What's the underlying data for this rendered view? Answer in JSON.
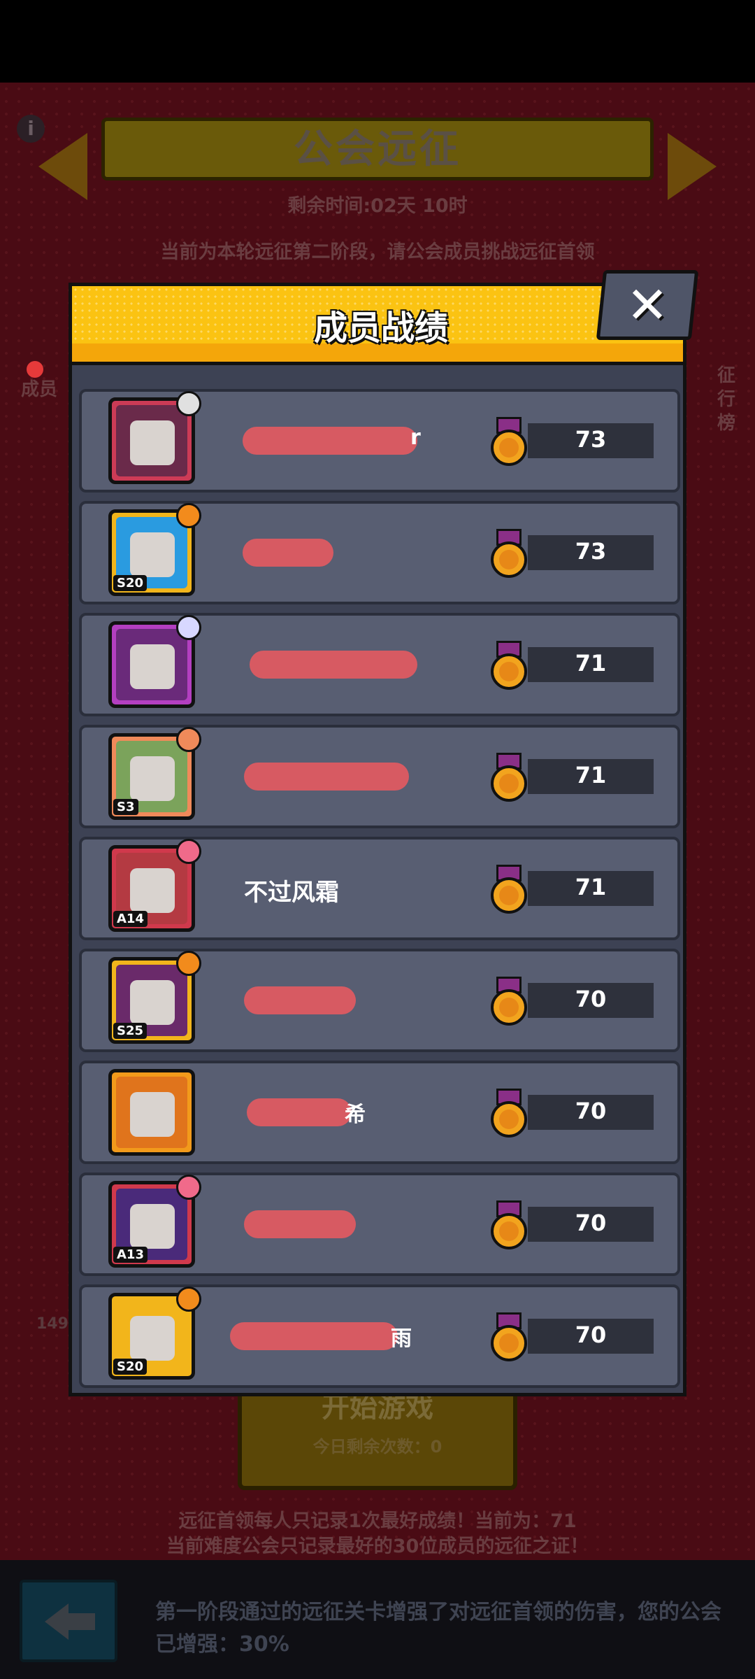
{
  "background": {
    "title": "公会远征",
    "time_remaining": "剩余时间:02天 10时",
    "stage_text": "当前为本轮远征第二阶段，请公会成员挑战远征首领",
    "left_label": "成员",
    "right_label": "征行榜",
    "left_number": "149",
    "start_button": "开始游戏",
    "today_remaining": "今日剩余次数：0",
    "note1": "远征首领每人只记录1次最好成绩！当前为：71",
    "note2": "当前难度公会只记录最好的30位成员的远征之证！",
    "boost_text": "第一阶段通过的远征关卡增强了对远征首领的伤害，您的公会已增强：30%"
  },
  "modal": {
    "title": "成员战绩",
    "close": "✕",
    "rows": [
      {
        "name": "",
        "name_suffix": "r",
        "score": "73",
        "tag": "",
        "frame": "#cc3b56",
        "bg": "#6a2a4a",
        "badge": "#e0e0e0"
      },
      {
        "name": "",
        "name_suffix": "",
        "score": "73",
        "tag": "S20",
        "frame": "#f2b51b",
        "bg": "#2a9be0",
        "badge": "#f28b1c"
      },
      {
        "name": "",
        "name_suffix": "",
        "score": "71",
        "tag": "",
        "frame": "#b33fc0",
        "bg": "#6a2a7a",
        "badge": "#d8d8ff"
      },
      {
        "name": "",
        "name_suffix": "",
        "score": "71",
        "tag": "S3",
        "frame": "#f08a5a",
        "bg": "#7ba35b",
        "badge": "#f08a5a"
      },
      {
        "name": "不过风霜",
        "name_suffix": "",
        "score": "71",
        "tag": "A14",
        "frame": "#d0394c",
        "bg": "#b43a42",
        "badge": "#f06a8a"
      },
      {
        "name": "",
        "name_suffix": "",
        "score": "70",
        "tag": "S25",
        "frame": "#f2b51b",
        "bg": "#6a2a6a",
        "badge": "#f28b1c"
      },
      {
        "name": "",
        "name_suffix": "希",
        "score": "70",
        "tag": "",
        "frame": "#f29a1b",
        "bg": "#e0741c",
        "badge": ""
      },
      {
        "name": "",
        "name_suffix": "",
        "score": "70",
        "tag": "A13",
        "frame": "#d0394c",
        "bg": "#4a2a7a",
        "badge": "#f06a8a"
      },
      {
        "name": "",
        "name_suffix": "雨",
        "score": "70",
        "tag": "S20",
        "frame": "#f2b51b",
        "bg": "#f2b51b",
        "badge": "#f28b1c"
      }
    ]
  }
}
